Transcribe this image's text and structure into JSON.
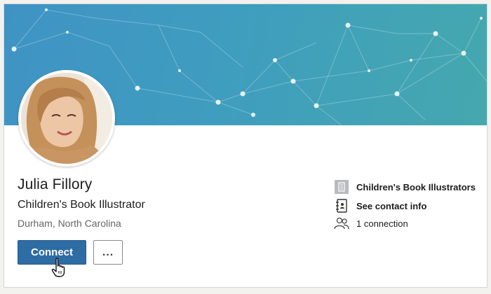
{
  "profile": {
    "name": "Julia Fillory",
    "headline": "Children's Book Illustrator",
    "location": "Durham, North Carolina"
  },
  "actions": {
    "connect_label": "Connect",
    "more_label": "..."
  },
  "sidebar": {
    "items": [
      {
        "icon": "company-logo-placeholder-icon",
        "label": "Children's Book Illustrators"
      },
      {
        "icon": "contact-book-icon",
        "label": "See contact info"
      },
      {
        "icon": "people-icon",
        "label": "1 connection"
      }
    ]
  },
  "colors": {
    "banner_start": "#3f93c4",
    "banner_end": "#45a8ae",
    "connect_button": "#2e6ca4"
  }
}
